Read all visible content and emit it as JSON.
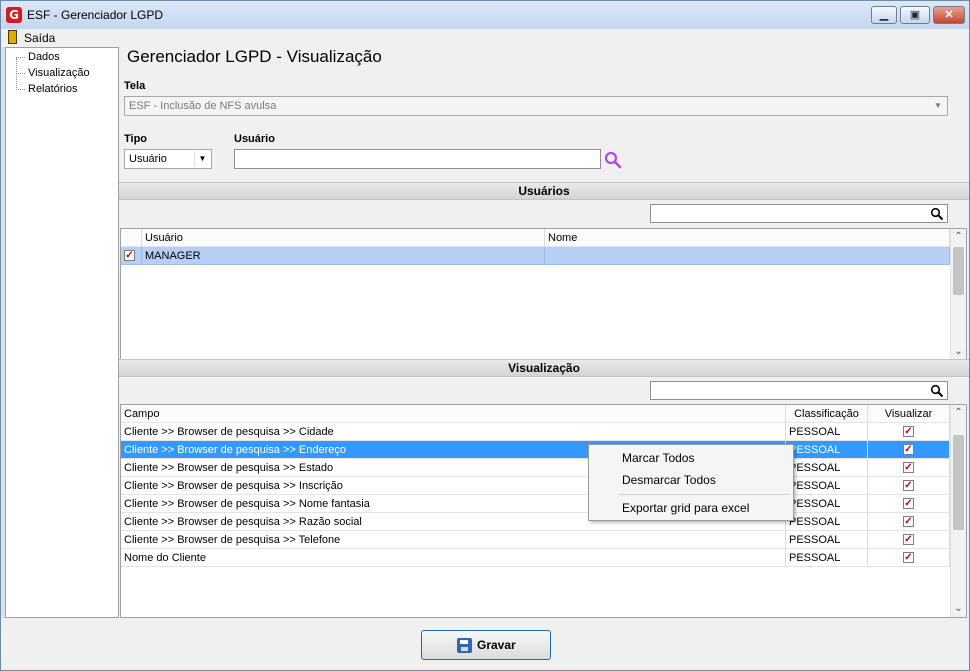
{
  "window": {
    "title": "ESF - Gerenciador LGPD",
    "icon_letter": "G",
    "controls": [
      "minimize-icon",
      "maximize-icon",
      "close-icon"
    ]
  },
  "menu": {
    "exit_label": "Saída"
  },
  "tree": {
    "items": [
      "Dados",
      "Visualização",
      "Relatórios"
    ]
  },
  "page": {
    "title": "Gerenciador LGPD - Visualização",
    "tela_label": "Tela",
    "tela_value": "ESF - Inclusão de NFS avulsa",
    "tipo_label": "Tipo",
    "tipo_value": "Usuário",
    "usuario_label": "Usuário",
    "usuario_value": ""
  },
  "usuarios": {
    "section_title": "Usuários",
    "filter_value": "",
    "columns": [
      "Usuário",
      "Nome"
    ],
    "rows": [
      {
        "checked": true,
        "usuario": "MANAGER",
        "nome": ""
      }
    ]
  },
  "visualizacao": {
    "section_title": "Visualização",
    "filter_value": "",
    "columns": [
      "Campo",
      "Classificação",
      "Visualizar"
    ],
    "rows": [
      {
        "campo": "Cliente >> Browser de pesquisa >> Cidade",
        "classificacao": "PESSOAL",
        "visualizar": true
      },
      {
        "campo": "Cliente >> Browser de pesquisa >> Endereço",
        "classificacao": "PESSOAL",
        "visualizar": true
      },
      {
        "campo": "Cliente >> Browser de pesquisa >> Estado",
        "classificacao": "PESSOAL",
        "visualizar": true
      },
      {
        "campo": "Cliente >> Browser de pesquisa >> Inscrição",
        "classificacao": "PESSOAL",
        "visualizar": true
      },
      {
        "campo": "Cliente >> Browser de pesquisa >> Nome fantasia",
        "classificacao": "PESSOAL",
        "visualizar": true
      },
      {
        "campo": "Cliente >> Browser de pesquisa >> Razão social",
        "classificacao": "PESSOAL",
        "visualizar": true
      },
      {
        "campo": "Cliente >> Browser de pesquisa >> Telefone",
        "classificacao": "PESSOAL",
        "visualizar": true
      },
      {
        "campo": "Nome do Cliente",
        "classificacao": "PESSOAL",
        "visualizar": true
      }
    ],
    "selected_row": 1
  },
  "context_menu": {
    "items": [
      "Marcar Todos",
      "Desmarcar Todos",
      "Exportar grid para excel"
    ]
  },
  "footer": {
    "save_label": "Gravar"
  },
  "colors": {
    "selection": "#3399ff",
    "user_row_selection": "#b7cff5",
    "title_accent": "#d71920",
    "search_icon": "#b04ae0",
    "save_border": "#1f68ae"
  }
}
